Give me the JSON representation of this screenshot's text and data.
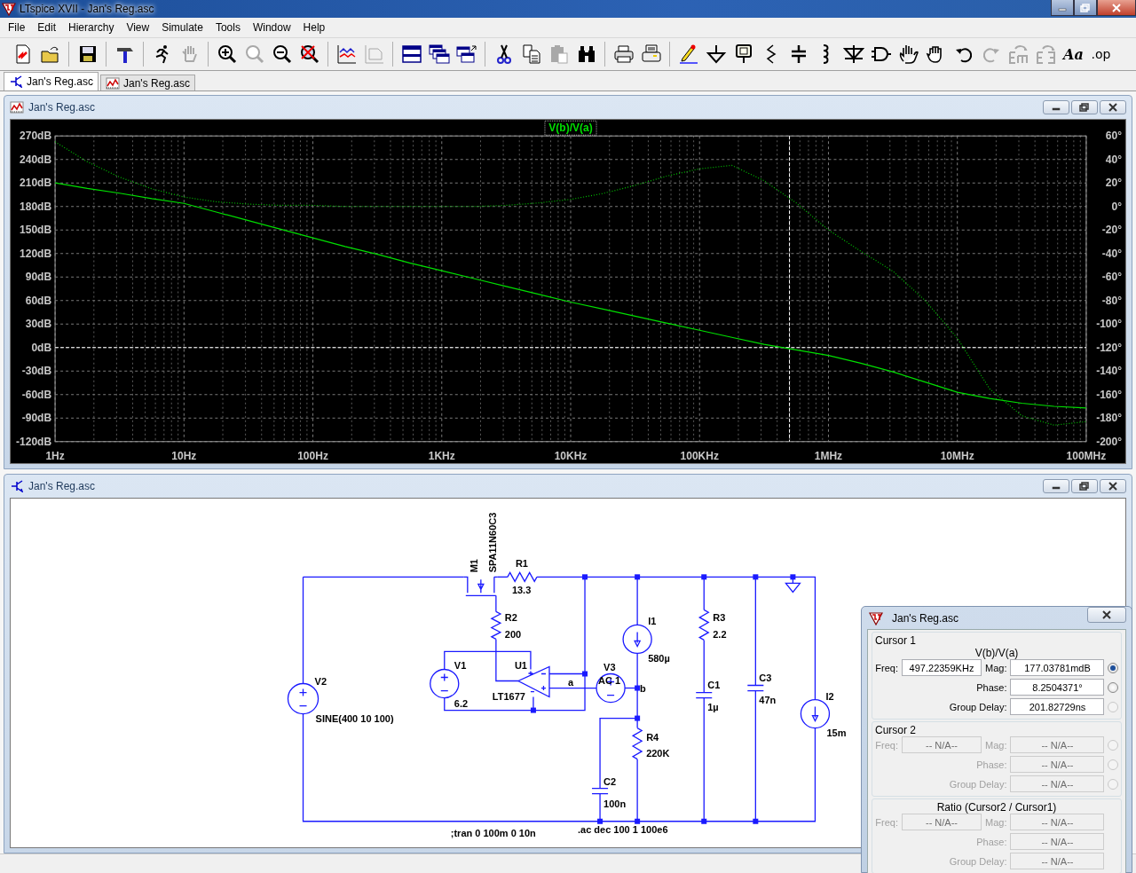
{
  "window": {
    "title": "LTspice XVII - Jan's Reg.asc"
  },
  "menu": [
    "File",
    "Edit",
    "Hierarchy",
    "View",
    "Simulate",
    "Tools",
    "Window",
    "Help"
  ],
  "toolbar": [
    {
      "kind": "new",
      "disabled": false
    },
    {
      "kind": "open",
      "disabled": false
    },
    {
      "kind": "separator"
    },
    {
      "kind": "save",
      "disabled": false
    },
    {
      "kind": "separator"
    },
    {
      "kind": "hammer",
      "disabled": false
    },
    {
      "kind": "separator"
    },
    {
      "kind": "run",
      "disabled": false
    },
    {
      "kind": "halt",
      "disabled": true
    },
    {
      "kind": "separator"
    },
    {
      "kind": "zoom_in",
      "disabled": false
    },
    {
      "kind": "zoom_back",
      "disabled": true
    },
    {
      "kind": "zoom_out",
      "disabled": false
    },
    {
      "kind": "zoom_fit",
      "disabled": false
    },
    {
      "kind": "separator"
    },
    {
      "kind": "autorange",
      "disabled": false
    },
    {
      "kind": "fft",
      "disabled": true
    },
    {
      "kind": "separator"
    },
    {
      "kind": "tile",
      "disabled": false
    },
    {
      "kind": "cascade",
      "disabled": false
    },
    {
      "kind": "arrange",
      "disabled": false
    },
    {
      "kind": "separator"
    },
    {
      "kind": "cut",
      "disabled": false
    },
    {
      "kind": "copy",
      "disabled": false
    },
    {
      "kind": "paste",
      "disabled": true
    },
    {
      "kind": "find",
      "disabled": false
    },
    {
      "kind": "separator"
    },
    {
      "kind": "print",
      "disabled": false
    },
    {
      "kind": "print_setup",
      "disabled": false
    },
    {
      "kind": "separator"
    },
    {
      "kind": "wire",
      "disabled": false
    },
    {
      "kind": "ground",
      "disabled": false
    },
    {
      "kind": "label",
      "disabled": false
    },
    {
      "kind": "resistor",
      "disabled": false
    },
    {
      "kind": "capacitor",
      "disabled": false
    },
    {
      "kind": "inductor",
      "disabled": false
    },
    {
      "kind": "diode",
      "disabled": false
    },
    {
      "kind": "component",
      "disabled": false
    },
    {
      "kind": "move",
      "disabled": false
    },
    {
      "kind": "drag",
      "disabled": false
    },
    {
      "kind": "undo",
      "disabled": false
    },
    {
      "kind": "redo",
      "disabled": true
    },
    {
      "kind": "rotate",
      "disabled": true
    },
    {
      "kind": "mirror",
      "disabled": true
    },
    {
      "kind": "text",
      "label": "Aa",
      "disabled": false
    },
    {
      "kind": "directive",
      "label": ".op",
      "disabled": false
    }
  ],
  "tabs": [
    {
      "kind": "schematic",
      "label": "Jan's Reg.asc",
      "selected": true
    },
    {
      "kind": "waveform",
      "label": "Jan's Reg.asc",
      "selected": false
    }
  ],
  "plot_window": {
    "title": "Jan's Reg.asc",
    "chart_data": {
      "type": "line",
      "grid": true,
      "ylim": [
        -120,
        270
      ],
      "y2lim": [
        -200,
        60
      ],
      "categories": [
        "1Hz",
        null,
        null,
        null,
        "10Hz",
        null,
        null,
        null,
        "100Hz",
        null,
        null,
        null,
        "1KHz",
        null,
        null,
        null,
        "10KHz",
        null,
        null,
        null,
        "100KHz",
        null,
        null,
        null,
        "1MHz",
        null,
        null,
        null,
        "10MHz",
        null,
        null,
        null,
        "100MHz"
      ],
      "yticks": [
        {
          "value": 270,
          "label": "270dB"
        },
        {
          "value": 240,
          "label": "240dB"
        },
        {
          "value": 210,
          "label": "210dB"
        },
        {
          "value": 180,
          "label": "180dB"
        },
        {
          "value": 150,
          "label": "150dB"
        },
        {
          "value": 120,
          "label": "120dB"
        },
        {
          "value": 90,
          "label": "90dB"
        },
        {
          "value": 60,
          "label": "60dB"
        },
        {
          "value": 30,
          "label": "30dB"
        },
        {
          "value": 0,
          "label": "0dB"
        },
        {
          "value": -30,
          "label": "-30dB"
        },
        {
          "value": -60,
          "label": "-60dB"
        },
        {
          "value": -90,
          "label": "-90dB"
        },
        {
          "value": -120,
          "label": "-120dB"
        }
      ],
      "y2ticks": [
        {
          "value": 60,
          "label": "60°"
        },
        {
          "value": 40,
          "label": "40°"
        },
        {
          "value": 20,
          "label": "20°"
        },
        {
          "value": 0,
          "label": "0°"
        },
        {
          "value": -20,
          "label": "-20°"
        },
        {
          "value": -40,
          "label": "-40°"
        },
        {
          "value": -60,
          "label": "-60°"
        },
        {
          "value": -80,
          "label": "-80°"
        },
        {
          "value": -100,
          "label": "-100°"
        },
        {
          "value": -120,
          "label": "-120°"
        },
        {
          "value": -140,
          "label": "-140°"
        },
        {
          "value": -160,
          "label": "-160°"
        },
        {
          "value": -180,
          "label": "-180°"
        },
        {
          "value": -200,
          "label": "-200°"
        }
      ],
      "series": [
        {
          "name": "V(b)/V(a)",
          "color": "#00e000",
          "values": [
            210,
            203,
            197,
            190,
            184,
            173,
            162,
            151,
            140,
            129,
            119,
            108,
            98,
            88,
            78,
            68,
            58,
            49,
            40,
            31,
            22,
            13,
            4,
            -3,
            -10,
            -20,
            -31,
            -44,
            -57,
            -65,
            -71,
            -75,
            -77
          ]
        },
        {
          "color": "#00c000",
          "axis": "y2",
          "line_style": "dotted",
          "values": [
            55,
            38,
            25,
            15,
            8,
            4,
            2,
            1,
            1,
            0,
            0,
            0,
            0,
            0,
            1,
            3,
            6,
            11,
            18,
            26,
            32,
            35,
            22,
            3,
            -20,
            -38,
            -55,
            -80,
            -112,
            -155,
            -178,
            -186,
            -183
          ]
        }
      ],
      "ref_lines": [
        {
          "axis": "y",
          "value": 0
        }
      ]
    }
  },
  "schematic_window": {
    "title": "Jan's Reg.asc",
    "components": [
      {
        "kind": "nmos",
        "ref": "M1",
        "value": "SPA11N60C3"
      },
      {
        "kind": "resistor_h",
        "ref": "R1",
        "value": "13.3"
      },
      {
        "kind": "resistor",
        "ref": "R2",
        "value": "200"
      },
      {
        "kind": "voltage_source",
        "ref": "V1",
        "value": "6.2"
      },
      {
        "kind": "opamp",
        "ref": "U1",
        "value": "LT1677"
      },
      {
        "kind": "voltage_source",
        "ref": "V3",
        "value": "AC 1"
      },
      {
        "kind": "current_source",
        "ref": "I1",
        "value": "580µ"
      },
      {
        "kind": "resistor",
        "ref": "R3",
        "value": "2.2"
      },
      {
        "kind": "voltage_source",
        "ref": "V2",
        "value": "SINE(400 10 100)"
      },
      {
        "kind": "capacitor",
        "ref": "C1",
        "value": "1µ"
      },
      {
        "kind": "capacitor",
        "ref": "C3",
        "value": "47n"
      },
      {
        "kind": "current_source",
        "ref": "I2",
        "value": "15m"
      },
      {
        "kind": "resistor",
        "ref": "R4",
        "value": "220K"
      },
      {
        "kind": "capacitor",
        "ref": "C2",
        "value": "100n"
      }
    ],
    "net_labels": [
      "a",
      "b"
    ],
    "directives": [
      ";tran 0 100m 0 10n",
      ".ac dec 100 1 100e6"
    ]
  },
  "cursor_dialog": {
    "title": "Jan's Reg.asc",
    "groups": [
      {
        "title": "Cursor 1",
        "trace": "V(b)/V(a)",
        "disabled": false,
        "fields": [
          {
            "label": "Freq:",
            "value": "497.22359KHz"
          },
          {
            "label": "Mag:",
            "value": "177.03781mdB",
            "radio": {
              "selected": true,
              "disabled": false
            }
          },
          {
            "label": "Phase:",
            "value": "8.2504371°",
            "radio": {
              "selected": false,
              "disabled": false
            }
          },
          {
            "label": "Group Delay:",
            "value": "201.82729ns",
            "radio": {
              "selected": false,
              "disabled": true
            }
          }
        ]
      },
      {
        "title": "Cursor 2",
        "disabled": true,
        "fields": [
          {
            "label": "Freq:",
            "value": "-- N/A--"
          },
          {
            "label": "Mag:",
            "value": "-- N/A--",
            "radio": {
              "selected": false,
              "disabled": true
            }
          },
          {
            "label": "Phase:",
            "value": "-- N/A--",
            "radio": {
              "selected": false,
              "disabled": true
            }
          },
          {
            "label": "Group Delay:",
            "value": "-- N/A--",
            "radio": {
              "selected": false,
              "disabled": true
            }
          }
        ]
      },
      {
        "title": "Ratio (Cursor2 / Cursor1)",
        "disabled": true,
        "fields": [
          {
            "label": "Freq:",
            "value": "-- N/A--"
          },
          {
            "label": "Mag:",
            "value": "-- N/A--"
          },
          {
            "label": "Phase:",
            "value": "-- N/A--"
          },
          {
            "label": "Group Delay:",
            "value": "-- N/A--"
          }
        ]
      }
    ]
  }
}
